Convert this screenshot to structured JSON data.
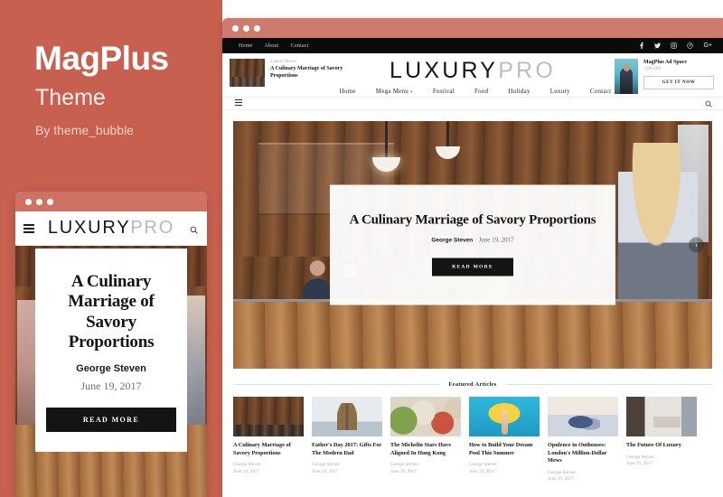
{
  "promo": {
    "title": "MagPlus",
    "subtitle": "Theme",
    "author": "By theme_bubble"
  },
  "window_controls": {
    "dot1": "",
    "dot2": "",
    "dot3": ""
  },
  "topbar": {
    "links": [
      {
        "label": "Home"
      },
      {
        "label": "About"
      },
      {
        "label": "Contact"
      }
    ],
    "social": [
      {
        "name": "facebook-icon",
        "glyph": "f"
      },
      {
        "name": "twitter-icon",
        "glyph": "✈"
      },
      {
        "name": "instagram-icon",
        "glyph": "▣"
      },
      {
        "name": "pinterest-icon",
        "glyph": "Ⓟ"
      },
      {
        "name": "google-plus-icon",
        "glyph": "G+"
      }
    ]
  },
  "latest_news": {
    "label": "Latest News",
    "title": "A Culinary Marriage of Savory Proportions"
  },
  "brand": {
    "primary": "LUXURY",
    "secondary": "PRO"
  },
  "ad": {
    "title": "MagPlus Ad Space",
    "size": "328x100",
    "button": "GET IT NOW"
  },
  "mainnav": {
    "items": [
      {
        "label": "Home",
        "has_caret": false
      },
      {
        "label": "Mega Menu",
        "has_caret": true
      },
      {
        "label": "Festival",
        "has_caret": false
      },
      {
        "label": "Food",
        "has_caret": false
      },
      {
        "label": "Holiday",
        "has_caret": false
      },
      {
        "label": "Luxury",
        "has_caret": false
      },
      {
        "label": "Contact",
        "has_caret": false
      }
    ]
  },
  "hero": {
    "title": "A Culinary Marriage of Savory Proportions",
    "author": "George Steven",
    "separator": "·",
    "date": "June 19, 2017",
    "button": "READ MORE",
    "next_arrow": "›"
  },
  "featured": {
    "heading": "Featured Articles",
    "cards": [
      {
        "title": "A Culinary Marriage of Savory Proportions",
        "author": "George Steven ·",
        "date": "June 19, 2017",
        "art": "img-kitchen"
      },
      {
        "title": "Father's Day 2017: Gifts For The Modern Dad",
        "author": "George Steven ·",
        "date": "June 19, 2017",
        "art": "img-ship"
      },
      {
        "title": "The Michelin Stars Have Aligned In Hong Kong",
        "author": "George Steven ·",
        "date": "June 19, 2017",
        "art": "img-food"
      },
      {
        "title": "How to Build Your Dream Pool This Summer",
        "author": "George Steven ·",
        "date": "June 19, 2017",
        "art": "img-pool"
      },
      {
        "title": "Opulence in Outhouses: London's Million-Dollar Mews",
        "author": "George Steven ·",
        "date": "June 19, 2017",
        "art": "img-bed"
      },
      {
        "title": "The Future Of Luxury",
        "author": "George Steven ·",
        "date": "June 19, 2017",
        "art": "img-interior"
      }
    ]
  },
  "mobile": {
    "brand_primary": "LUXURY",
    "brand_secondary": "PRO",
    "hero_title": "A Culinary Marriage of Savory Proportions",
    "hero_author": "George Steven",
    "hero_date": "June 19, 2017",
    "hero_button": "READ MORE"
  },
  "colors": {
    "brand_bg": "#c8604f",
    "titlebar": "#ce7b6e",
    "topbar": "#0b0b0b",
    "accent_dark": "#141414",
    "muted": "#adadad"
  }
}
